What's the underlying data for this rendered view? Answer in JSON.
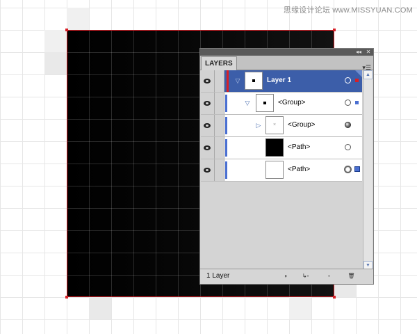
{
  "watermark": "思缘设计论坛 www.MISSYUAN.COM",
  "colors": {
    "selection_blue": "#3c5ea9",
    "layer_color_red": "#d81f26",
    "sublayer_color_blue": "#4a6fd1",
    "artwork_fill": "#000000"
  },
  "panel": {
    "title": "LAYERS",
    "titlebar_icons": [
      "collapse-icon",
      "close-icon"
    ],
    "menu_icon": "panel-menu-icon",
    "rows": [
      {
        "label": "Layer 1",
        "type": "layer",
        "selected": true,
        "expanded": true,
        "thumb": "white-with-dot",
        "target": "hollow",
        "selection_color": "#d81f26"
      },
      {
        "label": "<Group>",
        "type": "group",
        "selected": false,
        "expanded": true,
        "thumb": "white-with-dot",
        "target": "hollow",
        "selection_color": "#4a6fd1"
      },
      {
        "label": "<Group>",
        "type": "group",
        "selected": false,
        "expanded": false,
        "thumb": "white-x",
        "target": "filled",
        "selection_color": null
      },
      {
        "label": "<Path>",
        "type": "path",
        "selected": false,
        "expanded": null,
        "thumb": "black",
        "target": "hollow",
        "selection_color": null
      },
      {
        "label": "<Path>",
        "type": "path",
        "selected": false,
        "expanded": null,
        "thumb": "white",
        "target": "appearance",
        "selection_color": "#4a6fd1"
      }
    ],
    "footer": {
      "layer_count": "1 Layer",
      "buttons": [
        "make-clipping-mask-icon",
        "create-sublayer-icon",
        "create-layer-icon",
        "trash-icon"
      ]
    }
  }
}
